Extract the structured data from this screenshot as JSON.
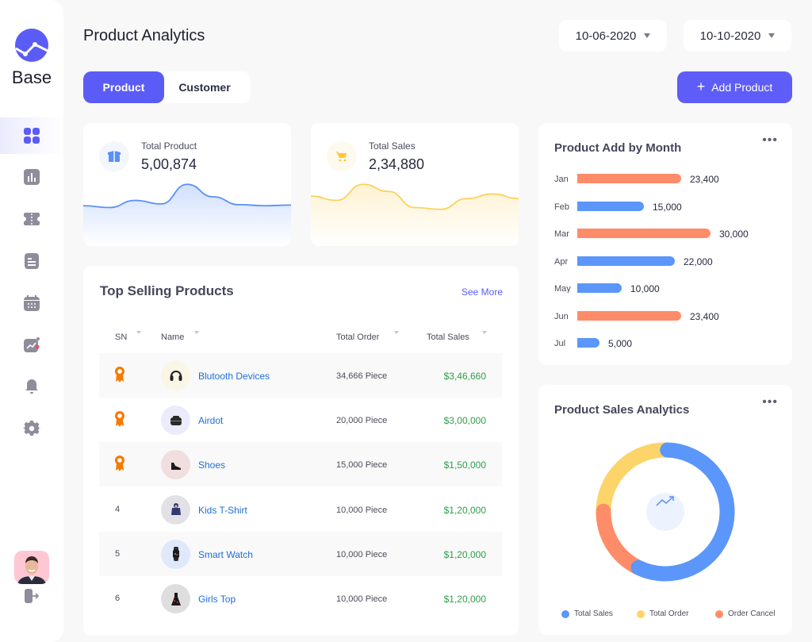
{
  "brand": {
    "name": "Base",
    "accent": "#5b5cf6"
  },
  "sidebar": {
    "items": [
      {
        "name": "dashboard",
        "icon": "grid-icon",
        "active": true
      },
      {
        "name": "analytics",
        "icon": "bar-chart-icon",
        "active": false
      },
      {
        "name": "tickets",
        "icon": "ticket-icon",
        "active": false
      },
      {
        "name": "documents",
        "icon": "document-icon",
        "active": false
      },
      {
        "name": "calendar",
        "icon": "calendar-icon",
        "active": false
      },
      {
        "name": "reports",
        "icon": "trend-chart-icon",
        "active": false
      },
      {
        "name": "notifications",
        "icon": "bell-icon",
        "active": false
      },
      {
        "name": "settings",
        "icon": "gear-icon",
        "active": false
      }
    ],
    "user_avatar": "user-avatar",
    "logout_icon": "logout-icon"
  },
  "header": {
    "title": "Product Analytics",
    "date_from": "10-06-2020",
    "date_to": "10-10-2020",
    "tabs": [
      {
        "label": "Product",
        "active": true
      },
      {
        "label": "Customer",
        "active": false
      }
    ],
    "add_button": "Add Product"
  },
  "stats": [
    {
      "label": "Total Product",
      "value": "5,00,874",
      "icon": "box-icon",
      "color": "#5b8ff9"
    },
    {
      "label": "Total Sales",
      "value": "2,34,880",
      "icon": "cart-icon",
      "color": "#fcd15b"
    }
  ],
  "top_selling": {
    "title": "Top Selling Products",
    "see_more": "See More",
    "columns": [
      "SN",
      "Name",
      "Total Order",
      "Total Sales"
    ],
    "rows": [
      {
        "sn": "1",
        "medal": true,
        "name": "Blutooth Devices",
        "order": "34,666 Piece",
        "sales": "$3,46,660",
        "thumb": "headphones"
      },
      {
        "sn": "2",
        "medal": true,
        "name": "Airdot",
        "order": "20,000 Piece",
        "sales": "$3,00,000",
        "thumb": "earbuds"
      },
      {
        "sn": "3",
        "medal": true,
        "name": "Shoes",
        "order": "15,000 Piece",
        "sales": "$1,50,000",
        "thumb": "shoe"
      },
      {
        "sn": "4",
        "medal": false,
        "name": "Kids T-Shirt",
        "order": "10,000 Piece",
        "sales": "$1,20,000",
        "thumb": "jacket"
      },
      {
        "sn": "5",
        "medal": false,
        "name": "Smart Watch",
        "order": "10,000 Piece",
        "sales": "$1,20,000",
        "thumb": "watch"
      },
      {
        "sn": "6",
        "medal": false,
        "name": "Girls Top",
        "order": "10,000 Piece",
        "sales": "$1,20,000",
        "thumb": "dress"
      }
    ]
  },
  "product_add": {
    "title": "Product Add  by Month",
    "menu": "•••"
  },
  "sales_analytics": {
    "title": "Product Sales Analytics",
    "menu": "•••"
  },
  "chart_data": [
    {
      "type": "bar",
      "orientation": "horizontal",
      "title": "Product Add  by Month",
      "categories": [
        "Jan",
        "Feb",
        "Mar",
        "Apr",
        "May",
        "Jun",
        "Jul"
      ],
      "values": [
        23400,
        15000,
        30000,
        22000,
        10000,
        23400,
        5000
      ],
      "value_labels": [
        "23,400",
        "15,000",
        "30,000",
        "22,000",
        "10,000",
        "23,400",
        "5,000"
      ],
      "colors": [
        "#ff8c69",
        "#5b96fa",
        "#ff8c69",
        "#5b96fa",
        "#5b96fa",
        "#ff8c69",
        "#5b96fa"
      ],
      "xlim": [
        0,
        30000
      ],
      "grid": false
    },
    {
      "type": "pie",
      "variant": "donut",
      "title": "Product Sales Analytics",
      "labels": [
        "Total Sales",
        "Total Order",
        "Order Cancel"
      ],
      "values": [
        57,
        25,
        18
      ],
      "colors": [
        "#5b96fa",
        "#fdd46a",
        "#ff8c69"
      ],
      "center_icon": "trend-up-icon",
      "legend": "bottom"
    },
    {
      "type": "area",
      "title": "Total Product",
      "x": [
        0,
        1,
        2,
        3,
        4,
        5,
        6,
        7,
        8
      ],
      "values": [
        0.35,
        0.3,
        0.5,
        0.4,
        0.95,
        0.6,
        0.38,
        0.35,
        0.37
      ],
      "color": "#5b8ff9"
    },
    {
      "type": "area",
      "title": "Total Sales",
      "x": [
        0,
        1,
        2,
        3,
        4,
        5,
        6,
        7,
        8
      ],
      "values": [
        0.62,
        0.5,
        0.95,
        0.75,
        0.3,
        0.25,
        0.55,
        0.68,
        0.55
      ],
      "color": "#fcd15b"
    }
  ]
}
